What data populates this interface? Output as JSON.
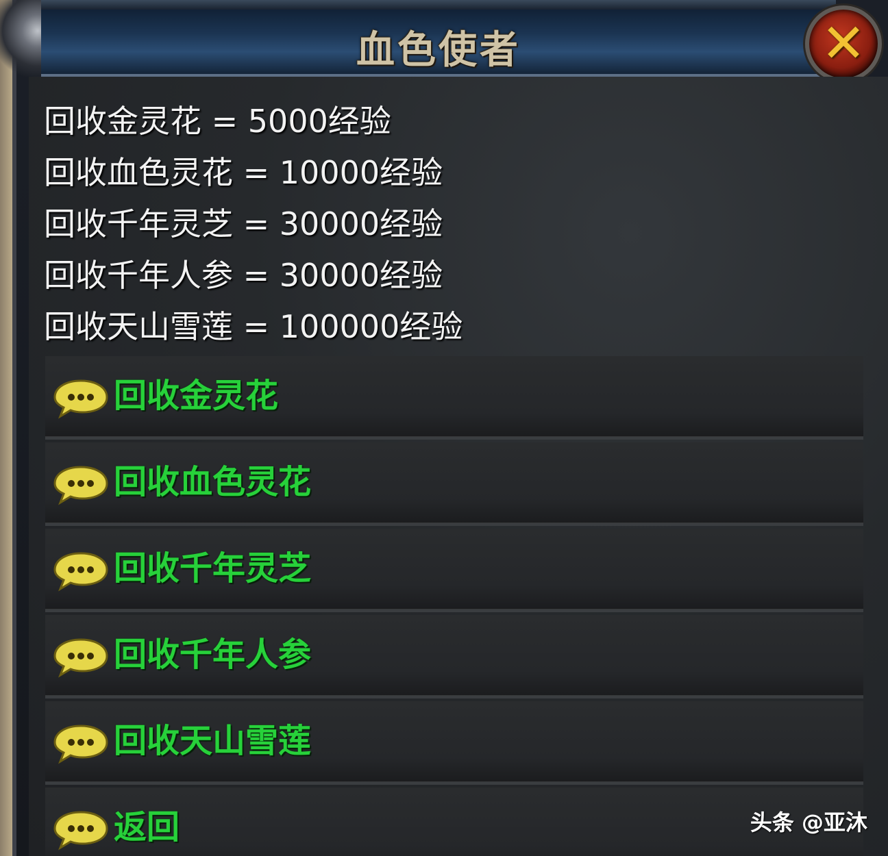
{
  "dialog": {
    "title": "血色使者",
    "close_icon": "close-x-icon"
  },
  "info_lines": [
    "回收金灵花 = 5000经验",
    "回收血色灵花 = 10000经验",
    "回收千年灵芝 = 30000经验",
    "回收千年人参 = 30000经验",
    "回收天山雪莲 = 100000经验"
  ],
  "options": [
    {
      "label": "回收金灵花",
      "icon": "speech-bubble-icon"
    },
    {
      "label": "回收血色灵花",
      "icon": "speech-bubble-icon"
    },
    {
      "label": "回收千年灵芝",
      "icon": "speech-bubble-icon"
    },
    {
      "label": "回收千年人参",
      "icon": "speech-bubble-icon"
    },
    {
      "label": "回收天山雪莲",
      "icon": "speech-bubble-icon"
    },
    {
      "label": "返回",
      "icon": "speech-bubble-icon"
    }
  ],
  "watermark": "头条 @亚沐",
  "colors": {
    "option_text": "#27d13a",
    "info_text": "#f3f3f3",
    "close_glyph": "#f2c233",
    "close_bg": "#8a1e10",
    "bubble": "#e6d74a"
  }
}
